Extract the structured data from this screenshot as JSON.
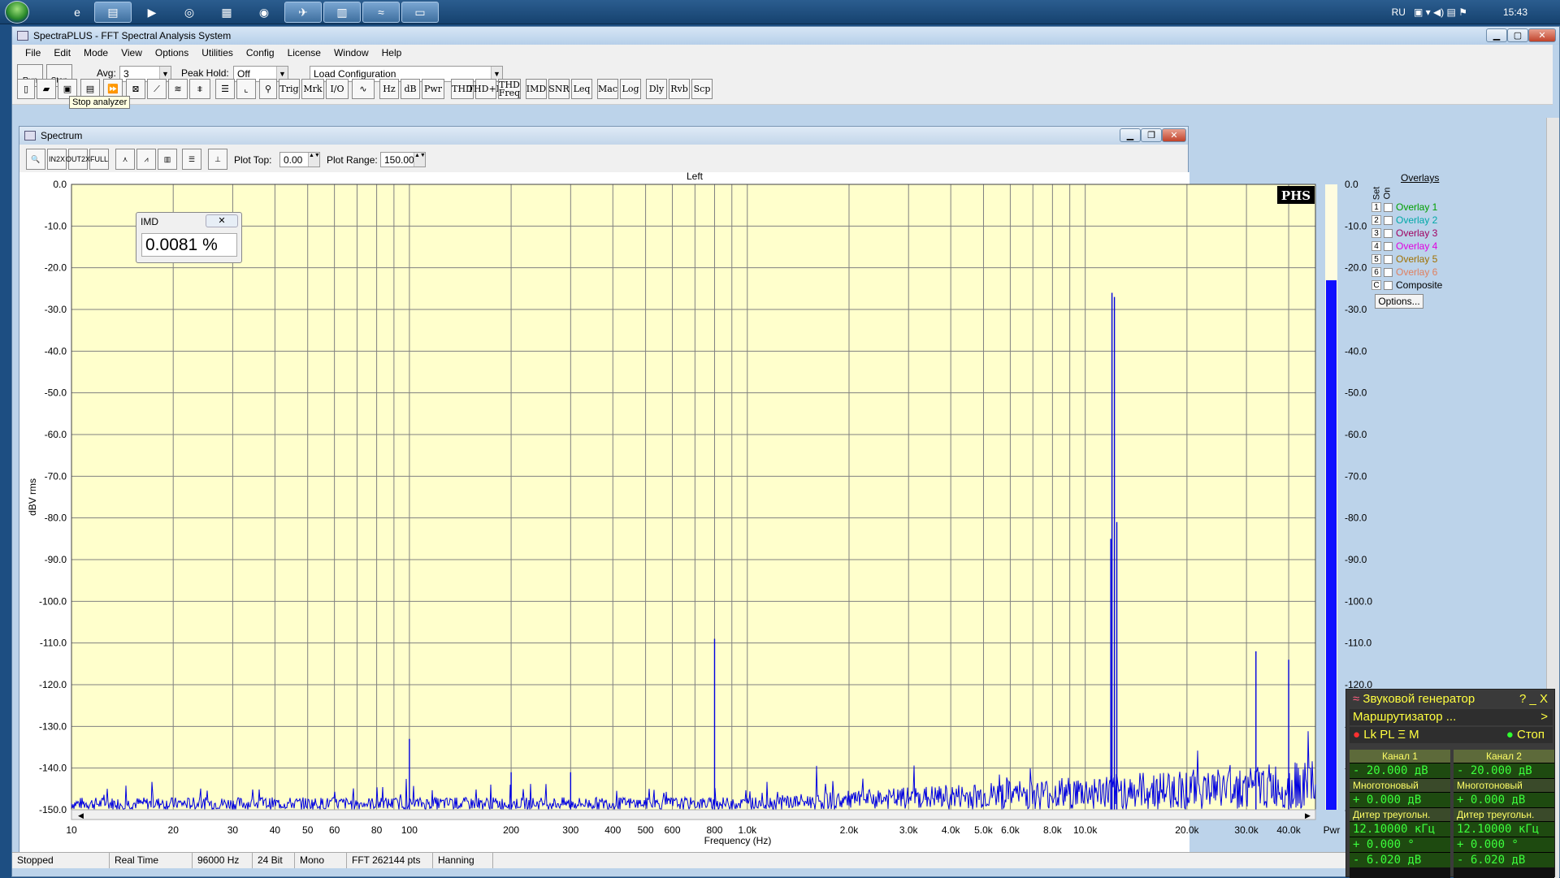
{
  "taskbar": {
    "language": "RU",
    "clock": "15:43"
  },
  "app": {
    "title": "SpectraPLUS - FFT Spectral Analysis System",
    "menu": [
      "File",
      "Edit",
      "Mode",
      "View",
      "Options",
      "Utilities",
      "Config",
      "License",
      "Window",
      "Help"
    ]
  },
  "toolbar": {
    "run_label": "Run",
    "stop_label": "Stop",
    "avg_label": "Avg:",
    "avg_value": "3",
    "peak_hold_label": "Peak Hold:",
    "peak_hold_value": "Off",
    "load_config_value": "Load Configuration",
    "tooltip": "Stop analyzer",
    "buttons": [
      "Trig",
      "Mrk",
      "I/O",
      "Hz",
      "dB",
      "Pwr",
      "THD",
      "THD+N",
      "THD Freq",
      "IMD",
      "SNR",
      "Leq",
      "Mac",
      "Log",
      "Dly",
      "Rvb",
      "Scp"
    ]
  },
  "spectrum": {
    "title": "Spectrum",
    "plot_top_label": "Plot Top:",
    "plot_top_value": "0.00",
    "plot_range_label": "Plot Range:",
    "plot_range_value": "150.00",
    "pwr_label": "Pwr"
  },
  "imd": {
    "title": "IMD",
    "value": "0.0081 %"
  },
  "overlays": {
    "header": "Overlays",
    "set_label": "Set",
    "on_label": "On",
    "options_label": "Options...",
    "items": [
      {
        "n": "1",
        "label": "Overlay 1",
        "color": "#00a000"
      },
      {
        "n": "2",
        "label": "Overlay 2",
        "color": "#00a8a8"
      },
      {
        "n": "3",
        "label": "Overlay 3",
        "color": "#a00060"
      },
      {
        "n": "4",
        "label": "Overlay 4",
        "color": "#e000e0"
      },
      {
        "n": "5",
        "label": "Overlay 5",
        "color": "#a07000"
      },
      {
        "n": "6",
        "label": "Overlay 6",
        "color": "#e08060"
      },
      {
        "n": "C",
        "label": "Composite",
        "color": "#000000"
      }
    ]
  },
  "status": [
    "Stopped",
    "Real Time",
    "96000 Hz",
    "24 Bit",
    "Mono",
    "FFT 262144 pts",
    "Hanning"
  ],
  "generator": {
    "title": "Звуковой генератор",
    "router": "Маршрутизатор ...",
    "flags": "Lk PL Ξ M",
    "stop_label": "Стоп",
    "channels": [
      {
        "name": "Канал 1",
        "level": "- 20.000 дВ",
        "type": "Многотоновый",
        "offset": "+ 0.000 дВ",
        "dither": "Дитер треугольн.",
        "freq": "12.10000 кГц",
        "phase": "+ 0.000 °",
        "level2": "- 6.020 дВ"
      },
      {
        "name": "Канал 2",
        "level": "- 20.000 дВ",
        "type": "Многотоновый",
        "offset": "+ 0.000 дВ",
        "dither": "Дитер треугольн.",
        "freq": "12.10000 кГц",
        "phase": "+ 0.000 °",
        "level2": "- 6.020 дВ"
      }
    ]
  },
  "chart_data": {
    "type": "line",
    "title": "Left",
    "xlabel": "Frequency (Hz)",
    "ylabel": "dBV rms",
    "xscale": "log",
    "xlim": [
      10,
      48000
    ],
    "ylim": [
      -150,
      0
    ],
    "x_ticks": [
      "10",
      "20",
      "30",
      "40",
      "50",
      "60",
      "80",
      "100",
      "200",
      "300",
      "400",
      "500",
      "600",
      "800",
      "1.0k",
      "2.0k",
      "3.0k",
      "4.0k",
      "5.0k",
      "6.0k",
      "8.0k",
      "10.0k",
      "20.0k",
      "30.0k",
      "40.0k"
    ],
    "y_ticks": [
      "0.0",
      "-10.0",
      "-20.0",
      "-30.0",
      "-40.0",
      "-50.0",
      "-60.0",
      "-70.0",
      "-80.0",
      "-90.0",
      "-100.0",
      "-110.0",
      "-120.0",
      "-130.0",
      "-140.0",
      "-150.0"
    ],
    "series": [
      {
        "color": "#0000e0",
        "peaks": [
          {
            "x": 100,
            "y": -133
          },
          {
            "x": 200,
            "y": -141
          },
          {
            "x": 300,
            "y": -141
          },
          {
            "x": 800,
            "y": -109
          },
          {
            "x": 12000,
            "y": -26
          },
          {
            "x": 12200,
            "y": -27
          },
          {
            "x": 11900,
            "y": -85
          },
          {
            "x": 12400,
            "y": -81
          },
          {
            "x": 32000,
            "y": -112
          },
          {
            "x": 40000,
            "y": -114
          }
        ],
        "noise_floor": -150
      }
    ],
    "bar_level_db": -23,
    "logo": "PHS"
  }
}
